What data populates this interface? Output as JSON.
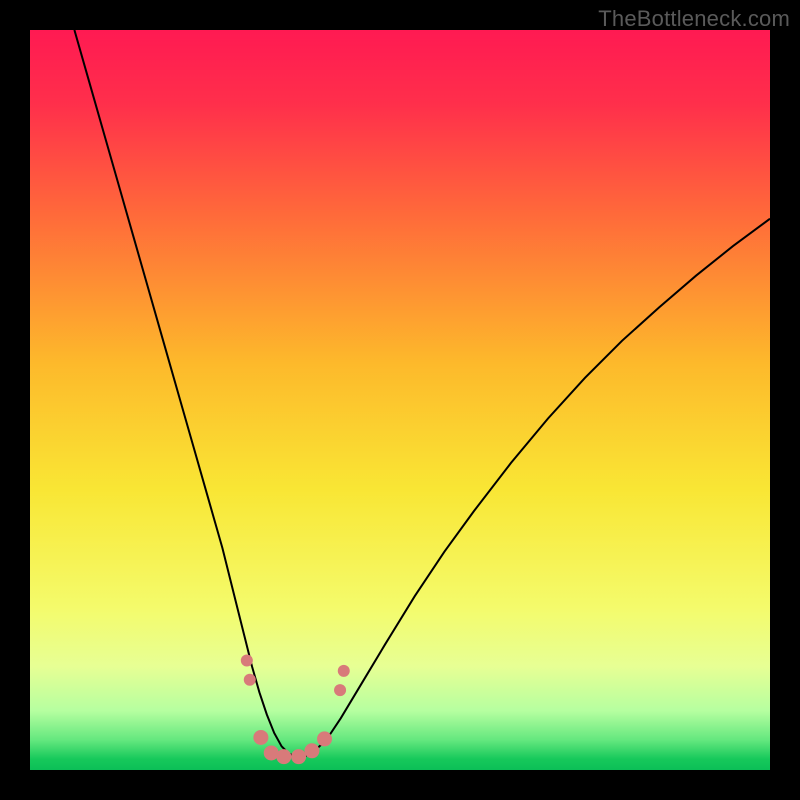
{
  "watermark": "TheBottleneck.com",
  "chart_data": {
    "type": "line",
    "title": "",
    "xlabel": "",
    "ylabel": "",
    "xlim": [
      0,
      100
    ],
    "ylim": [
      0,
      100
    ],
    "background_gradient": {
      "stops": [
        {
          "offset": 0.0,
          "color": "#ff1a52"
        },
        {
          "offset": 0.1,
          "color": "#ff2f4b"
        },
        {
          "offset": 0.25,
          "color": "#ff6a3a"
        },
        {
          "offset": 0.45,
          "color": "#fdb92b"
        },
        {
          "offset": 0.62,
          "color": "#f9e634"
        },
        {
          "offset": 0.78,
          "color": "#f4fb6b"
        },
        {
          "offset": 0.86,
          "color": "#e7ff94"
        },
        {
          "offset": 0.92,
          "color": "#b6ffa0"
        },
        {
          "offset": 0.96,
          "color": "#63e77e"
        },
        {
          "offset": 0.985,
          "color": "#17c95b"
        },
        {
          "offset": 1.0,
          "color": "#0cbf57"
        }
      ]
    },
    "series": [
      {
        "name": "curve",
        "color": "#000000",
        "width": 2,
        "x": [
          6,
          8,
          10,
          12,
          14,
          16,
          18,
          20,
          22,
          24,
          25,
          26,
          27,
          28,
          29,
          30,
          31,
          32,
          33,
          34,
          35,
          36,
          37,
          38,
          40,
          42,
          45,
          48,
          52,
          56,
          60,
          65,
          70,
          75,
          80,
          85,
          90,
          95,
          100
        ],
        "y": [
          100,
          93,
          86,
          79,
          72,
          65,
          58,
          51,
          44,
          37,
          33.5,
          30,
          26,
          22,
          18,
          14,
          10.5,
          7.5,
          5,
          3.2,
          2.2,
          1.8,
          1.8,
          2.2,
          4,
          7,
          12,
          17,
          23.5,
          29.5,
          35,
          41.5,
          47.5,
          53,
          58,
          62.5,
          66.8,
          70.8,
          74.5
        ]
      }
    ],
    "markers": {
      "color": "#d87a7a",
      "radius_small": 6,
      "radius_large": 7.5,
      "points": [
        {
          "x": 29.3,
          "y": 14.8,
          "r": "small"
        },
        {
          "x": 29.7,
          "y": 12.2,
          "r": "small"
        },
        {
          "x": 31.2,
          "y": 4.4,
          "r": "large"
        },
        {
          "x": 32.6,
          "y": 2.3,
          "r": "large"
        },
        {
          "x": 34.3,
          "y": 1.8,
          "r": "large"
        },
        {
          "x": 36.3,
          "y": 1.8,
          "r": "large"
        },
        {
          "x": 38.1,
          "y": 2.6,
          "r": "large"
        },
        {
          "x": 39.8,
          "y": 4.2,
          "r": "large"
        },
        {
          "x": 41.9,
          "y": 10.8,
          "r": "small"
        },
        {
          "x": 42.4,
          "y": 13.4,
          "r": "small"
        }
      ]
    }
  }
}
